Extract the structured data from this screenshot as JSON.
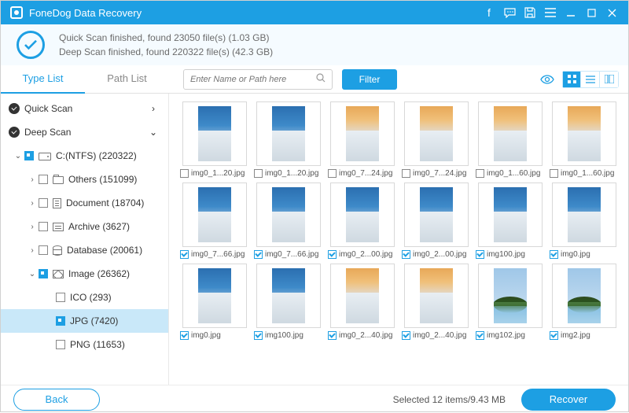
{
  "titlebar": {
    "title": "FoneDog Data Recovery"
  },
  "summary": {
    "quick": "Quick Scan finished, found 23050 file(s) (1.03 GB)",
    "deep": "Deep Scan finished, found 220322 file(s) (42.3 GB)"
  },
  "tabs": {
    "type_list": "Type List",
    "path_list": "Path List"
  },
  "toolbar": {
    "search_placeholder": "Enter Name or Path here",
    "filter": "Filter"
  },
  "sidebar": {
    "quick_scan": "Quick Scan",
    "deep_scan": "Deep Scan",
    "drive": "C:(NTFS) (220322)",
    "others": "Others (151099)",
    "document": "Document (18704)",
    "archive": "Archive (3627)",
    "database": "Database (20061)",
    "image": "Image (26362)",
    "ico": "ICO (293)",
    "jpg": "JPG (7420)",
    "png": "PNG (11653)"
  },
  "grid": [
    {
      "name": "img0_1...20.jpg",
      "checked": false,
      "variant": "blue"
    },
    {
      "name": "img0_1...20.jpg",
      "checked": false,
      "variant": "blue"
    },
    {
      "name": "img0_7...24.jpg",
      "checked": false,
      "variant": "sunset"
    },
    {
      "name": "img0_7...24.jpg",
      "checked": false,
      "variant": "sunset"
    },
    {
      "name": "img0_1...60.jpg",
      "checked": false,
      "variant": "sunset"
    },
    {
      "name": "img0_1...60.jpg",
      "checked": false,
      "variant": "sunset"
    },
    {
      "name": "img0_7...66.jpg",
      "checked": true,
      "variant": "blue"
    },
    {
      "name": "img0_7...66.jpg",
      "checked": true,
      "variant": "blue"
    },
    {
      "name": "img0_2...00.jpg",
      "checked": true,
      "variant": "blue"
    },
    {
      "name": "img0_2...00.jpg",
      "checked": true,
      "variant": "blue"
    },
    {
      "name": "img100.jpg",
      "checked": true,
      "variant": "blue"
    },
    {
      "name": "img0.jpg",
      "checked": true,
      "variant": "blue"
    },
    {
      "name": "img0.jpg",
      "checked": true,
      "variant": "blue"
    },
    {
      "name": "img100.jpg",
      "checked": true,
      "variant": "blue"
    },
    {
      "name": "img0_2...40.jpg",
      "checked": true,
      "variant": "sunset"
    },
    {
      "name": "img0_2...40.jpg",
      "checked": true,
      "variant": "sunset"
    },
    {
      "name": "img102.jpg",
      "checked": true,
      "variant": "island"
    },
    {
      "name": "img2.jpg",
      "checked": true,
      "variant": "island"
    }
  ],
  "footer": {
    "back": "Back",
    "selected": "Selected 12 items/9.43 MB",
    "recover": "Recover"
  },
  "colors": {
    "blue": "linear-gradient(#2b6fb0 0%,#3e8ac9 35%,#87b3d9 55%)",
    "sunset": "linear-gradient(#e8a858 0%,#f0c07a 25%,#dfe1e4 55%)"
  }
}
